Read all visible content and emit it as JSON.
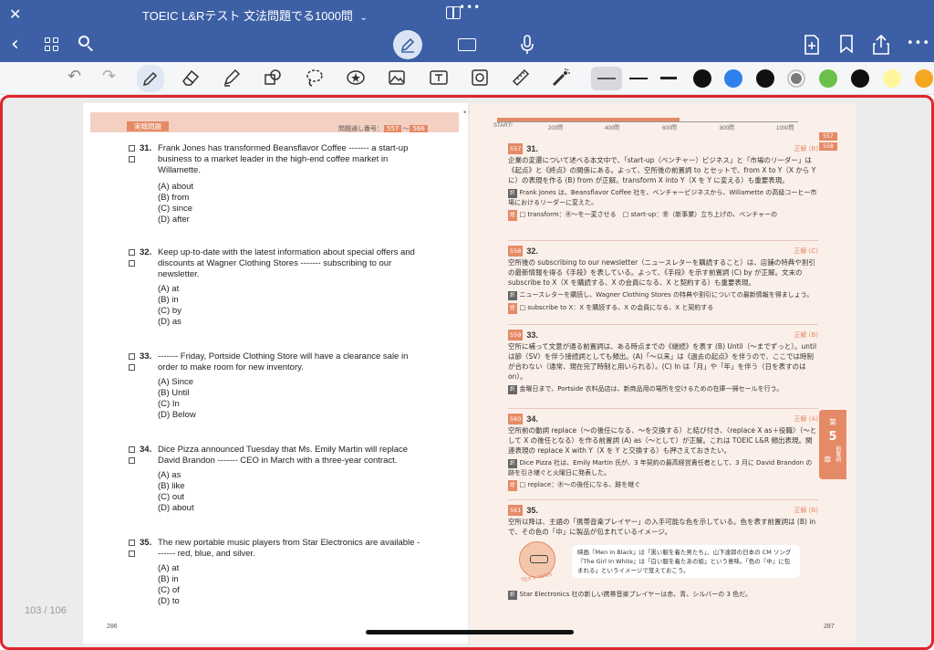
{
  "window": {
    "title": "TOEIC L&Rテスト 文法問題でる1000問",
    "title_chevron": "⌄",
    "close_glyph": "✕"
  },
  "toolbar": {
    "back_glyph": "‹",
    "more_glyph": "•••"
  },
  "annotation_tools": {
    "undo_glyph": "↶",
    "redo_glyph": "↷",
    "colors": [
      "#111111",
      "#2f80ed",
      "#111111",
      "#7a7a7a",
      "#6cc04a",
      "#111111",
      "#fff59d",
      "#f5a623"
    ],
    "selected_color_index": 3
  },
  "document": {
    "page_counter": "103 / 106",
    "left": {
      "section_label": "実戦問題",
      "meta_label": "問題通し番号：",
      "meta_from": "557",
      "meta_to": "566",
      "folio": "286",
      "questions": [
        {
          "num": "31.",
          "stem": "Frank Jones has transformed Beansflavor Coffee ------- a start-up business to a market leader in the high-end coffee market in Willamette.",
          "options": [
            "(A) about",
            "(B) from",
            "(C) since",
            "(D) after"
          ]
        },
        {
          "num": "32.",
          "stem": "Keep up-to-date with the latest information about special offers and discounts at Wagner Clothing Stores ------- subscribing to our newsletter.",
          "options": [
            "(A) at",
            "(B) in",
            "(C) by",
            "(D) as"
          ]
        },
        {
          "num": "33.",
          "stem": "------- Friday, Portside Clothing Store will have a clearance sale in order to make room for new inventory.",
          "options": [
            "(A) Since",
            "(B) Until",
            "(C) In",
            "(D) Below"
          ]
        },
        {
          "num": "34.",
          "stem": "Dice Pizza announced Tuesday that Ms. Emily Martin will replace David Brandon ------- CEO in March with a three-year contract.",
          "options": [
            "(A) as",
            "(B) like",
            "(C) out",
            "(D) about"
          ]
        },
        {
          "num": "35.",
          "stem": "The new portable music players from Star Electronics are available ------- red, blue, and silver.",
          "options": [
            "(A) at",
            "(B) in",
            "(C) of",
            "(D) to"
          ]
        }
      ]
    },
    "right": {
      "folio": "287",
      "axis_ticks": [
        "START!",
        "200問",
        "400問",
        "600問",
        "800問",
        "1000問"
      ],
      "side_numbers": [
        "557",
        "558"
      ],
      "chapter_tab": {
        "label": "前置詞",
        "prefix": "第",
        "num": "5",
        "suffix": "章"
      },
      "answers": [
        {
          "tag": "557",
          "num": "31.",
          "key": "正解 (B)",
          "body": "企業の変遷について述べる本文中で、「start-up（ベンチャー）ビジネス」と「市場のリーダー」は《起点》と《終点》の関係にある。よって、空所後の前置詞 to とセットで、from X to Y（X から Y に）の表現を作る (B) from が正解。transform X into Y（X を Y に変える）も重要表現。",
          "note": "Frank Jones は、Beansflavor Coffee 社を、ベンチャービジネスから、Willamette の高級コーヒー市場におけるリーダーに変えた。",
          "vocab": "□ transform：㊍～を一変させる　□ start-up：㊎（新事業）立ち上げの、ベンチャーの"
        },
        {
          "tag": "558",
          "num": "32.",
          "key": "正解 (C)",
          "body": "空所後の subscribing to our newsletter（ニュースレターを購読すること）は、店舗の特典や割引の最新情報を得る《手段》を表している。よって、《手段》を示す前置詞 (C) by が正解。文末の subscribe to X（X を購読する、X の会員になる、X と契約する）も重要表現。",
          "note": "ニュースレターを購読し、Wagner Clothing Stores の特典や割引についての最新情報を得ましょう。",
          "vocab": "□ subscribe to X：X を購読する、X の会員になる、X と契約する"
        },
        {
          "tag": "559",
          "num": "33.",
          "key": "正解 (B)",
          "body": "空所に補って文意が通る前置詞は、ある時点までの《継続》を表す (B) Until（～までずっと）。until は節〈SV〉を伴う接続詞としても頻出。(A)「～以来」は《過去の起点》を伴うので、ここでは時制が合わない（通常、現在完了時制と用いられる）。(C) In は「月」や「年」を伴う（日を表すのは on）。",
          "note": "金曜日まで、Portside 衣料品店は、新商品用の場所を空けるための在庫一掃セールを行う。",
          "vocab": ""
        },
        {
          "tag": "560",
          "num": "34.",
          "key": "正解 (A)",
          "body": "空所前の動詞 replace（～の後任になる、～を交換する）と結び付き、〈replace X as＋役職〉（～として X の後任となる）を作る前置詞 (A) as（～として）が正解。これは TOEIC L&R 頻出表現。関連表現の replace X with Y（X を Y と交換する）も押さえておきたい。",
          "note": "Dice Pizza 社は、Emily Martin 氏が、3 年契約の最高経営責任者として、3 月に David Brandon の跡を引き継ぐと火曜日に発表した。",
          "vocab": "□ replace：㊍～の後任になる、跡を継ぐ"
        },
        {
          "tag": "561",
          "num": "35.",
          "key": "正解 (B)",
          "body": "空所以降は、主語の「携帯音楽プレイヤー」の入手可能な色を示している。色を表す前置詞は (B) in で、その色の「中」に製品が包まれているイメージ。",
          "note": "Star Electronics 社の新しい携帯音楽プレイヤーは赤、青、シルバーの 3 色だ。",
          "vocab": ""
        }
      ],
      "tips": {
        "badge": "TEX's notes",
        "text": "映画『Men in Black』は「黒い服を着た男たち」、山下達郎の日本の CM ソング『The Girl In White』は「白い服を着たあの娘」という意味。「色の『中』に包まれる」というイメージで覚えておこう。"
      }
    }
  }
}
